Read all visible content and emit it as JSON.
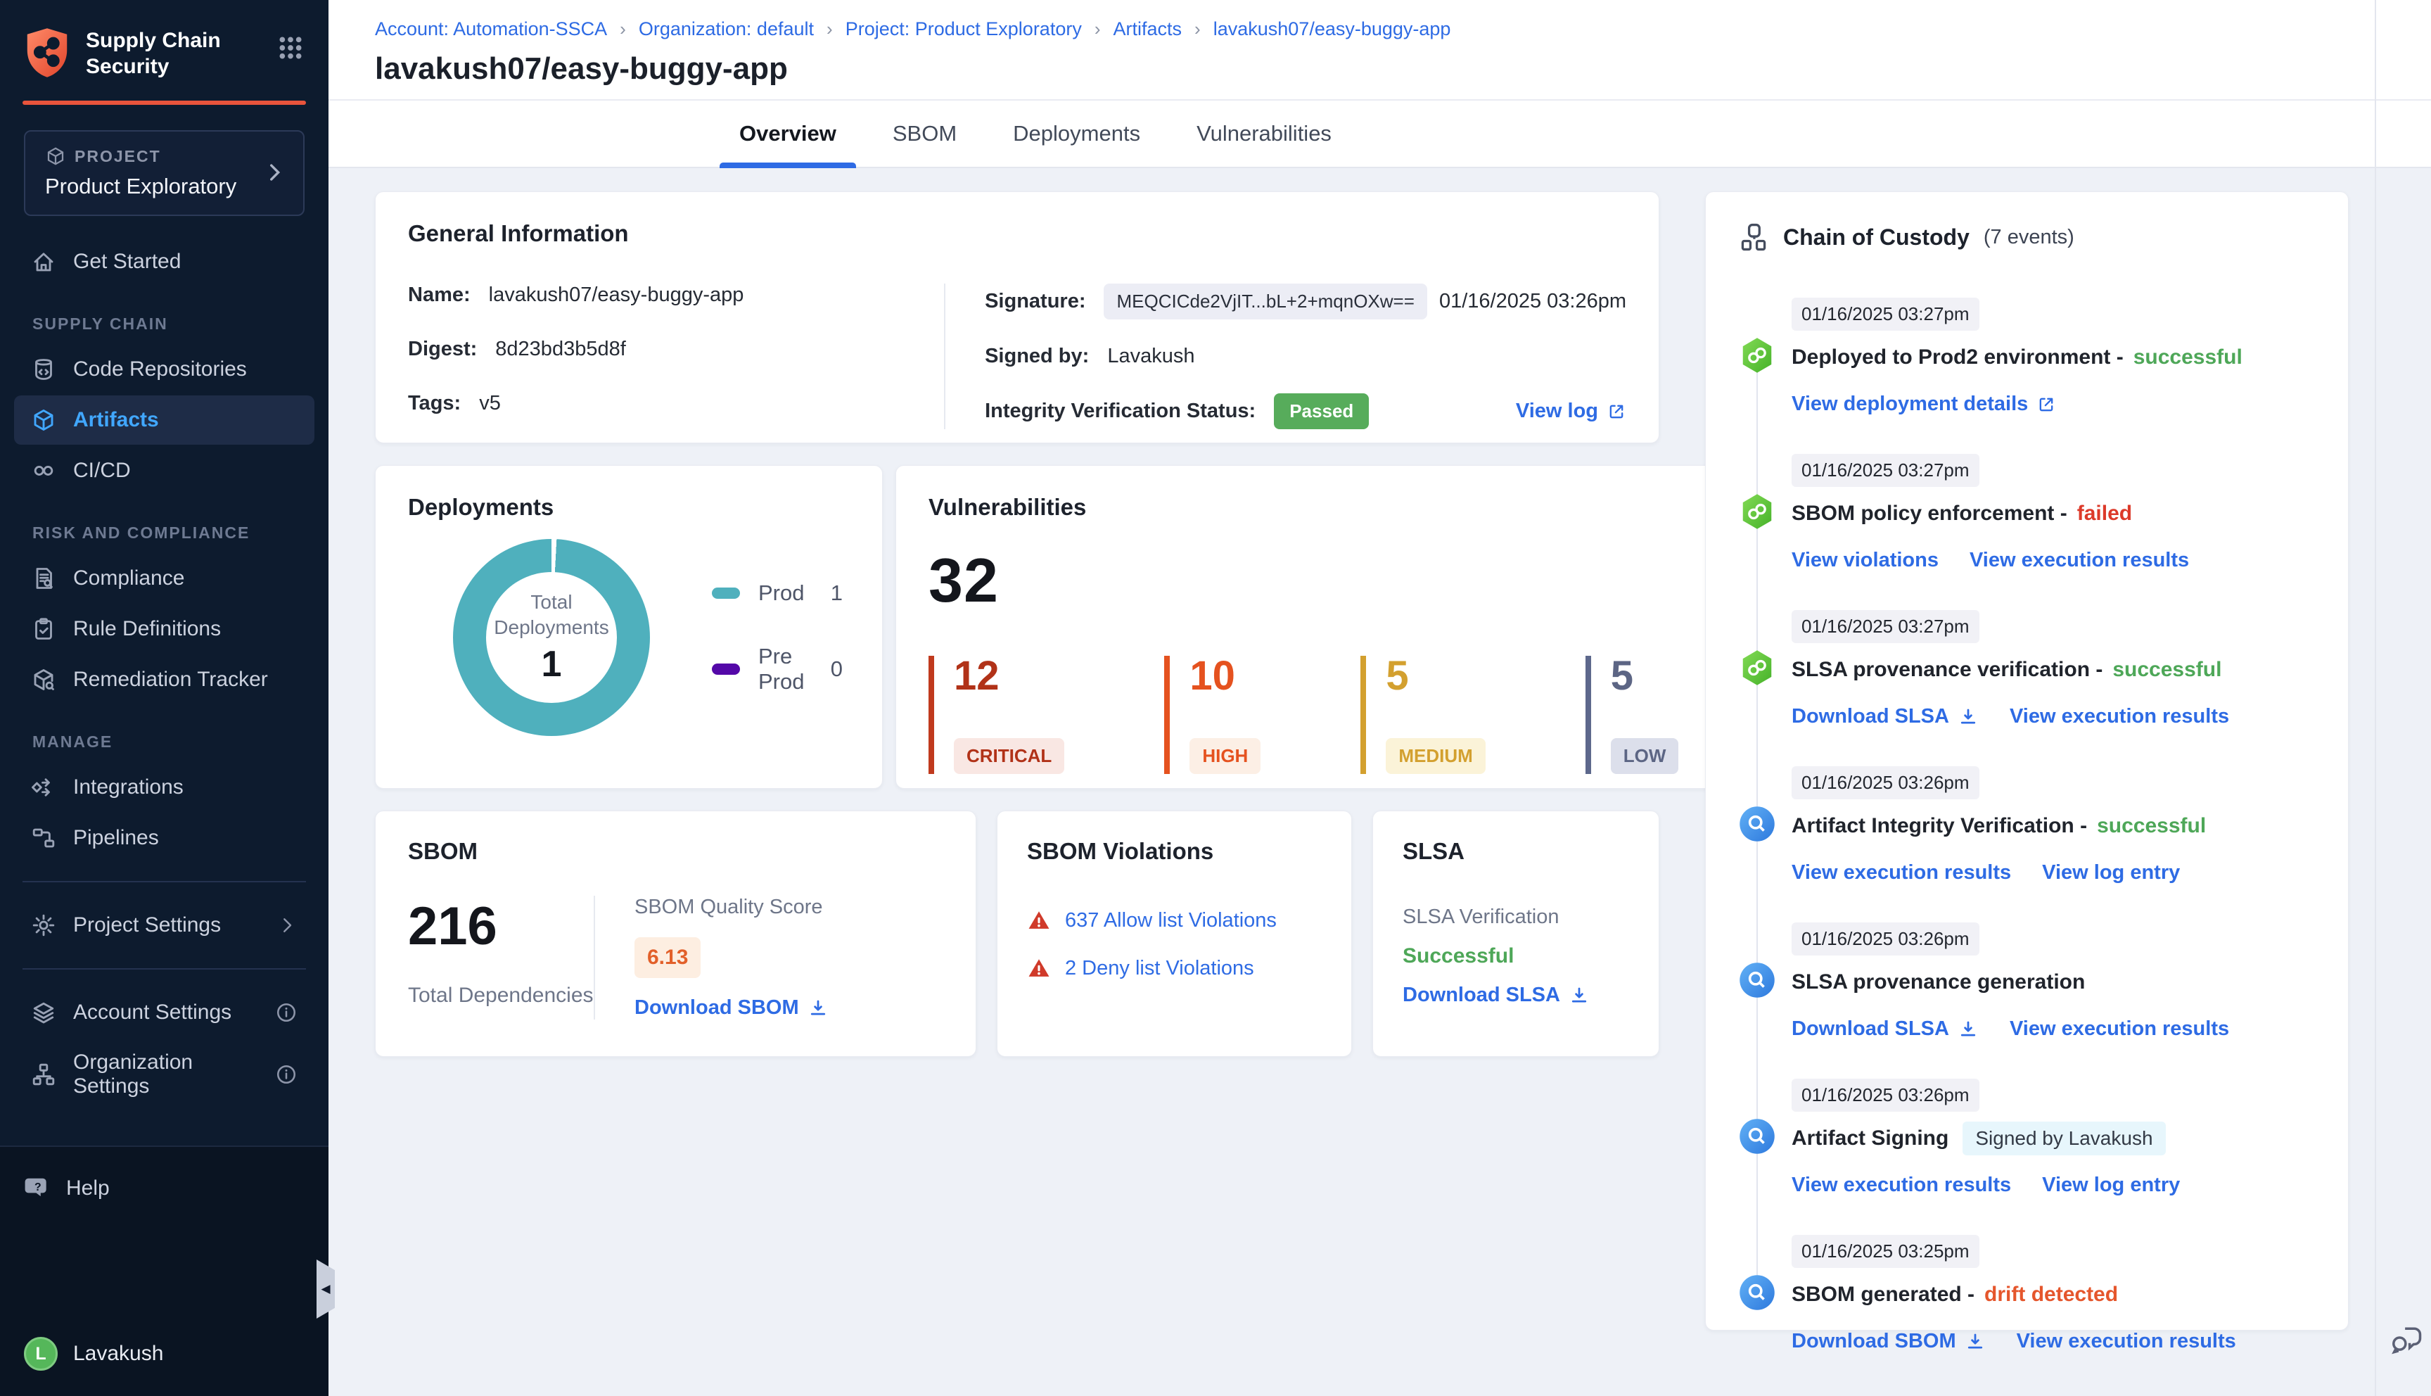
{
  "app": {
    "title": "Supply Chain Security"
  },
  "colors": {
    "accent_orange": "#e8543c",
    "link_blue": "#2e6be4",
    "active_nav_blue": "#41a7ff",
    "success_green": "#4ea758",
    "passed_badge_green": "#57ac5b",
    "failed_red": "#dc3a2a",
    "drift_orange": "#e5562c",
    "teal": "#4fb0bd",
    "pre_prod_purple": "#5408a8",
    "sidebar_navy": "#0d1b2e"
  },
  "sidebar": {
    "project": {
      "label": "PROJECT",
      "name": "Product Exploratory"
    },
    "nav": [
      {
        "type": "item",
        "label": "Get Started",
        "icon": "home"
      },
      {
        "type": "section",
        "label": "SUPPLY CHAIN"
      },
      {
        "type": "item",
        "label": "Code Repositories",
        "icon": "code-repo"
      },
      {
        "type": "item",
        "label": "Artifacts",
        "icon": "cube",
        "active": true
      },
      {
        "type": "item",
        "label": "CI/CD",
        "icon": "infinity"
      },
      {
        "type": "section",
        "label": "RISK AND COMPLIANCE"
      },
      {
        "type": "item",
        "label": "Compliance",
        "icon": "doc-search"
      },
      {
        "type": "item",
        "label": "Rule Definitions",
        "icon": "clipboard-check"
      },
      {
        "type": "item",
        "label": "Remediation Tracker",
        "icon": "box-wrench"
      },
      {
        "type": "section",
        "label": "MANAGE"
      },
      {
        "type": "item",
        "label": "Integrations",
        "icon": "integrations"
      },
      {
        "type": "item",
        "label": "Pipelines",
        "icon": "pipelines"
      },
      {
        "type": "divider"
      },
      {
        "type": "item",
        "label": "Project Settings",
        "icon": "gear",
        "chevron": true
      },
      {
        "type": "divider"
      },
      {
        "type": "item",
        "label": "Account Settings",
        "icon": "layers",
        "info": true
      },
      {
        "type": "item",
        "label": "Organization Settings",
        "icon": "org",
        "info": true
      }
    ],
    "footer": {
      "help": "Help",
      "user": "Lavakush",
      "avatar_initial": "L"
    }
  },
  "breadcrumb": [
    "Account: Automation-SSCA",
    "Organization: default",
    "Project: Product Exploratory",
    "Artifacts",
    "lavakush07/easy-buggy-app"
  ],
  "page": {
    "title": "lavakush07/easy-buggy-app"
  },
  "tabs": [
    {
      "label": "Overview",
      "active": true
    },
    {
      "label": "SBOM"
    },
    {
      "label": "Deployments"
    },
    {
      "label": "Vulnerabilities"
    }
  ],
  "general_info": {
    "title": "General Information",
    "name_label": "Name:",
    "name": "lavakush07/easy-buggy-app",
    "digest_label": "Digest:",
    "digest": "8d23bd3b5d8f",
    "tags_label": "Tags:",
    "tags": "v5",
    "signature_label": "Signature:",
    "signature": "MEQCICde2VjIT...bL+2+mqnOXw==",
    "signature_date": "01/16/2025 03:26pm",
    "signed_by_label": "Signed by:",
    "signed_by": "Lavakush",
    "integrity_label": "Integrity Verification Status:",
    "integrity_status": "Passed",
    "view_log": "View log"
  },
  "deployments": {
    "title": "Deployments",
    "center_label": "Total Deployments",
    "total": "1",
    "legend": [
      {
        "name": "Prod",
        "value": "1",
        "color": "#4fb0bd"
      },
      {
        "name": "Pre Prod",
        "value": "0",
        "color": "#5408a8"
      }
    ]
  },
  "chart_data": {
    "type": "pie",
    "title": "Total Deployments",
    "categories": [
      "Prod",
      "Pre Prod"
    ],
    "values": [
      1,
      0
    ],
    "total": 1,
    "colors": [
      "#4fb0bd",
      "#5408a8"
    ],
    "legend_position": "right"
  },
  "vulnerabilities": {
    "title": "Vulnerabilities",
    "total": "32",
    "severities": [
      {
        "label": "CRITICAL",
        "count": "12",
        "text_color": "#b13218",
        "bar_color": "#c03a1e",
        "badge_bg": "#f9e7e3"
      },
      {
        "label": "HIGH",
        "count": "10",
        "text_color": "#e5521f",
        "bar_color": "#e5521f",
        "badge_bg": "#fcefe5"
      },
      {
        "label": "MEDIUM",
        "count": "5",
        "text_color": "#d3a02f",
        "bar_color": "#d3a02f",
        "badge_bg": "#fbf3d8"
      },
      {
        "label": "LOW",
        "count": "5",
        "text_color": "#5c6584",
        "bar_color": "#5d688c",
        "badge_bg": "#dcdfeb"
      }
    ]
  },
  "sbom": {
    "title": "SBOM",
    "total": "216",
    "total_label": "Total Dependencies",
    "score_label": "SBOM Quality Score",
    "score": "6.13",
    "download": "Download SBOM"
  },
  "sbom_violations": {
    "title": "SBOM Violations",
    "items": [
      {
        "text": "637 Allow list Violations"
      },
      {
        "text": "2 Deny list Violations"
      }
    ]
  },
  "slsa": {
    "title": "SLSA",
    "verification_label": "SLSA Verification",
    "status": "Successful",
    "download": "Download SLSA"
  },
  "chain": {
    "title": "Chain of Custody",
    "events_count": "(7 events)",
    "events": [
      {
        "time": "01/16/2025 03:27pm",
        "icon": "green-link",
        "title": "Deployed to Prod2 environment",
        "status": "successful",
        "status_color": "green",
        "links": [
          {
            "text": "View deployment details",
            "icon": "external"
          }
        ]
      },
      {
        "time": "01/16/2025 03:27pm",
        "icon": "green-link",
        "title": "SBOM policy enforcement",
        "status": "failed",
        "status_color": "red",
        "links": [
          {
            "text": "View violations"
          },
          {
            "text": "View execution results"
          }
        ]
      },
      {
        "time": "01/16/2025 03:27pm",
        "icon": "green-link",
        "title": "SLSA provenance verification",
        "status": "successful",
        "status_color": "green",
        "links": [
          {
            "text": "Download SLSA",
            "icon": "download"
          },
          {
            "text": "View execution results"
          }
        ]
      },
      {
        "time": "01/16/2025 03:26pm",
        "icon": "blue-scan",
        "title": "Artifact Integrity Verification",
        "status": "successful",
        "status_color": "green",
        "links": [
          {
            "text": "View execution results"
          },
          {
            "text": "View log entry"
          }
        ]
      },
      {
        "time": "01/16/2025 03:26pm",
        "icon": "blue-scan",
        "title": "SLSA provenance generation",
        "links": [
          {
            "text": "Download SLSA",
            "icon": "download"
          },
          {
            "text": "View execution results"
          }
        ]
      },
      {
        "time": "01/16/2025 03:26pm",
        "icon": "blue-scan",
        "title": "Artifact Signing",
        "badge": "Signed by Lavakush",
        "links": [
          {
            "text": "View execution results"
          },
          {
            "text": "View log entry"
          }
        ]
      },
      {
        "time": "01/16/2025 03:25pm",
        "icon": "blue-scan",
        "title": "SBOM generated",
        "status": "drift detected",
        "status_color": "orange",
        "links": [
          {
            "text": "Download SBOM",
            "icon": "download"
          },
          {
            "text": "View execution results"
          }
        ]
      }
    ]
  }
}
